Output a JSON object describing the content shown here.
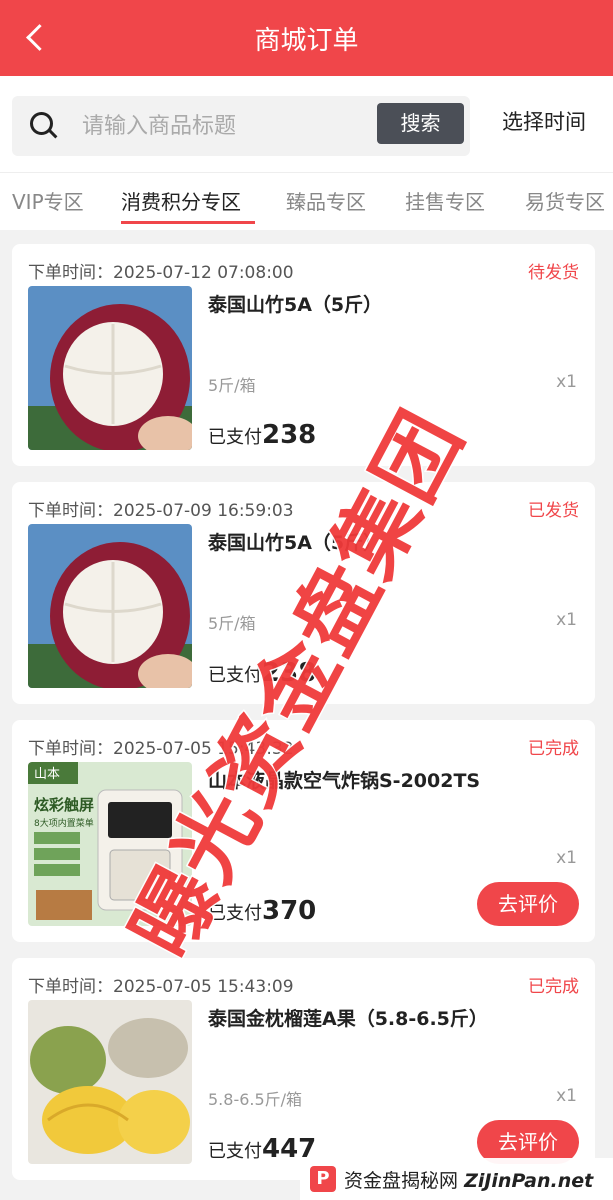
{
  "header": {
    "title": "商城订单"
  },
  "search": {
    "placeholder": "请输入商品标题",
    "button": "搜索",
    "time_filter": "选择时间"
  },
  "tabs": [
    {
      "label": "VIP专区",
      "active": false
    },
    {
      "label": "消费积分专区",
      "active": true
    },
    {
      "label": "臻品专区",
      "active": false
    },
    {
      "label": "挂售专区",
      "active": false
    },
    {
      "label": "易货专区",
      "active": false
    }
  ],
  "orders": [
    {
      "time_label": "下单时间：",
      "time": "2025-07-12 07:08:00",
      "status": "待发货",
      "name": "泰国山竹5A（5斤）",
      "spec": "5斤/箱",
      "qty": "x1",
      "paid_label": "已支付",
      "amount": "238",
      "action": ""
    },
    {
      "time_label": "下单时间：",
      "time": "2025-07-09 16:59:03",
      "status": "已发货",
      "name": "泰国山竹5A（5斤）",
      "spec": "5斤/箱",
      "qty": "x1",
      "paid_label": "已支付",
      "amount": "238",
      "action": ""
    },
    {
      "time_label": "下单时间：",
      "time": "2025-07-05 15:43:32",
      "status": "已完成",
      "name": "山本液晶款空气炸锅S-2002TS",
      "spec": "",
      "qty": "x1",
      "paid_label": "已支付",
      "amount": "370",
      "action": "去评价"
    },
    {
      "time_label": "下单时间：",
      "time": "2025-07-05 15:43:09",
      "status": "已完成",
      "name": "泰国金枕榴莲A果（5.8-6.5斤）",
      "spec": "5.8-6.5斤/箱",
      "qty": "x1",
      "paid_label": "已支付",
      "amount": "447",
      "action": "去评价"
    }
  ],
  "thumb_texts": {
    "brand": "山本",
    "promo": "炫彩触屏",
    "sub": "8大项内置菜单"
  },
  "watermark": "曝光资金盘集团",
  "footer": {
    "logo": "P",
    "site_cn": "资金盘揭秘网",
    "site_en": "ZiJinPan.net"
  },
  "colors": {
    "primary": "#f0464a",
    "search_button": "#4b4f57"
  }
}
